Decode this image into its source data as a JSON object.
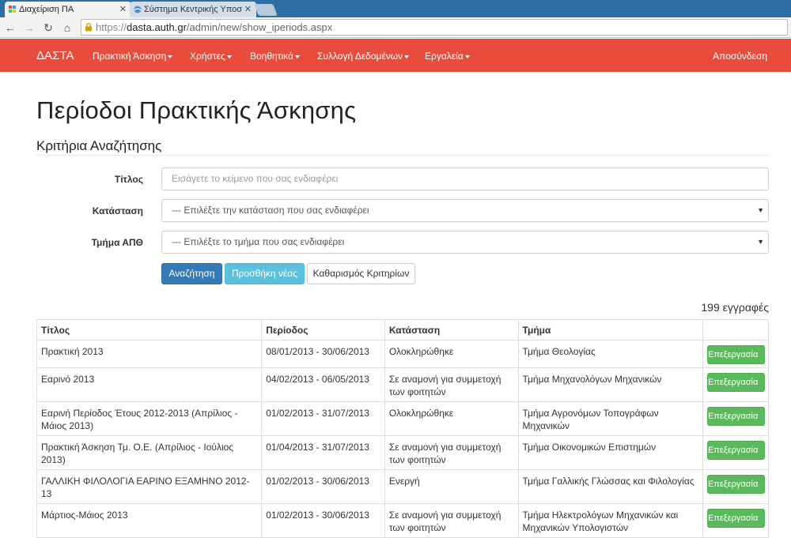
{
  "browser": {
    "tabs": [
      {
        "title": "Διαχείριση ΠΑ",
        "active": true
      },
      {
        "title": "Σύστημα Κεντρικής Υποσ",
        "active": false
      }
    ],
    "url": {
      "scheme": "https://",
      "host": "dasta.auth.gr",
      "path": "/admin/new/show_iperiods.aspx"
    },
    "icons": [
      "back-icon",
      "forward-icon",
      "reload-icon",
      "home-icon",
      "lock-icon"
    ]
  },
  "navbar": {
    "brand": "ΔΑΣΤΑ",
    "menu": [
      "Πρακτική Άσκηση",
      "Χρήστες",
      "Βοηθητικά",
      "Συλλογή Δεδομένων",
      "Εργαλεία"
    ],
    "logout": "Αποσύνδεση",
    "color": "#e74c3c"
  },
  "page": {
    "title": "Περίοδοι Πρακτικής Άσκησης",
    "subtitle": "Κριτήρια Αναζήτησης"
  },
  "form": {
    "title_label": "Τίτλος",
    "title_placeholder": "Εισάγετε το κείμενο που σας ενδιαφέρει",
    "status_label": "Κατάσταση",
    "status_selected": "--- Επιλέξτε την κατάσταση που σας ενδιαφέρει",
    "dept_label": "Τμήμα ΑΠΘ",
    "dept_selected": "--- Επιλέξτε το τμήμα που σας ενδιαφέρει",
    "search_button": "Αναζήτηση",
    "add_button": "Προσθήκη νέας",
    "clear_button": "Καθαρισμός Κριτηρίων"
  },
  "results": {
    "count": "199 εγγραφές",
    "columns": [
      "Τίτλος",
      "Περίοδος",
      "Κατάσταση",
      "Τμήμα",
      ""
    ],
    "edit_label": "Επεξεργασία",
    "rows": [
      {
        "title": "Πρακτική 2013",
        "period": "08/01/2013 - 30/06/2013",
        "status": "Ολοκληρώθηκε",
        "dept": "Τμήμα Θεολογίας"
      },
      {
        "title": "Εαρινό 2013",
        "period": "04/02/2013 - 06/05/2013",
        "status": "Σε αναμονή για συμμετοχή των φοιτητών",
        "dept": "Τμήμα Μηχανολόγων Μηχανικών"
      },
      {
        "title": "Εαρινή Περίοδος Έτους 2012-2013 (Απρίλιος - Μάιος 2013)",
        "period": "01/02/2013 - 31/07/2013",
        "status": "Ολοκληρώθηκε",
        "dept": "Τμήμα Αγρονόμων Τοπογράφων Μηχανικών"
      },
      {
        "title": "Πρακτική Άσκηση Τμ. Ο.Ε. (Απρίλιος - Ιούλιος 2013)",
        "period": "01/04/2013 - 31/07/2013",
        "status": "Σε αναμονή για συμμετοχή των φοιτητών",
        "dept": "Τμήμα Οικονομικών Επιστημών"
      },
      {
        "title": "ΓΑΛΛΙΚΗ ΦΙΛΟΛΟΓΙΑ ΕΑΡΙΝΟ ΕΞΑΜΗΝΟ 2012-13",
        "period": "01/02/2013 - 30/06/2013",
        "status": "Ενεργή",
        "dept": "Τμήμα Γαλλικής Γλώσσας και Φιλολογίας"
      },
      {
        "title": "Μάρτιος-Μάιος 2013",
        "period": "01/02/2013 - 30/06/2013",
        "status": "Σε αναμονή για συμμετοχή των φοιτητών",
        "dept": "Τμήμα Ηλεκτρολόγων Μηχανικών και Μηχανικών Υπολογιστών"
      }
    ]
  }
}
